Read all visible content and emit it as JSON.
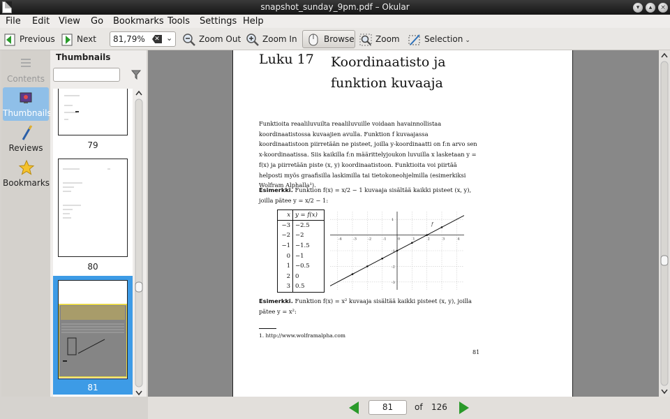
{
  "window": {
    "title": "snapshot_sunday_9pm.pdf – Okular"
  },
  "colors": {
    "accent": "#3d9be6",
    "nav_green": "#2a9a2a",
    "sidebar_active": "#8fbfe8"
  },
  "menu": [
    "File",
    "Edit",
    "View",
    "Go",
    "Bookmarks",
    "Tools",
    "Settings",
    "Help"
  ],
  "toolbar": {
    "previous": "Previous",
    "next": "Next",
    "zoom_value": "81,79%",
    "zoom_out": "Zoom Out",
    "zoom_in": "Zoom In",
    "browse": "Browse",
    "zoom": "Zoom",
    "selection": "Selection"
  },
  "sidebar": {
    "items": [
      {
        "label": "Contents",
        "icon": "contents-icon"
      },
      {
        "label": "Thumbnails",
        "icon": "thumbnails-icon"
      },
      {
        "label": "Reviews",
        "icon": "reviews-icon"
      },
      {
        "label": "Bookmarks",
        "icon": "bookmarks-star-icon"
      }
    ]
  },
  "thumbnails": {
    "title": "Thumbnails",
    "pages": [
      "79",
      "80",
      "81"
    ]
  },
  "document": {
    "chapter_number": "Luku 17",
    "chapter_title": "Koordinaatisto ja funktion kuvaaja",
    "paragraph": "Funktioita reaaliluvuilta reaaliluvuille voidaan havainnollistaa koordinaatistossa kuvaajien avulla. Funktion f kuvaajassa koordinaatistoon piirretään ne pisteet, joilla y-koordinaatti on f:n arvo sen x-koordinaatissa. Siis kaikilla f:n määrittelyjoukon luvuilla x lasketaan y = f(x) ja piirretään piste (x, y) koordinaatistoon. Funktioita voi piirtää helposti myös graafisilla laskimilla tai tietokoneohjelmilla (esimerkiksi Wolfram Alphalla¹).",
    "example1_label": "Esimerkki.",
    "example1_text": " Funktion f(x) = x/2 − 1 kuvaaja sisältää kaikki pisteet (x, y), joilla pätee y = x/2 − 1:",
    "table_headers": [
      "x",
      "y = f(x)"
    ],
    "table_rows": [
      [
        "−3",
        "−2.5"
      ],
      [
        "−2",
        "−2"
      ],
      [
        "−1",
        "−1.5"
      ],
      [
        "0",
        "−1"
      ],
      [
        "1",
        "−0.5"
      ],
      [
        "2",
        "0"
      ],
      [
        "3",
        "0.5"
      ]
    ],
    "example2_label": "Esimerkki.",
    "example2_text": " Funktion f(x) = x² kuvaaja sisältää kaikki pisteet (x, y), joilla pätee y = x²:",
    "footnote": "1.   http://www.wolframalpha.com",
    "page_number": "81"
  },
  "plot": {
    "x_ticks": [
      "-4",
      "-3",
      "-2",
      "-1",
      "0",
      "1",
      "2",
      "3",
      "4"
    ],
    "y_ticks": [
      "1",
      "-1",
      "-2",
      "-3"
    ],
    "curve_label": "f",
    "points": [
      [
        -3,
        -2.5
      ],
      [
        -2,
        -2
      ],
      [
        -1,
        -1.5
      ],
      [
        0,
        -1
      ],
      [
        1,
        -0.5
      ],
      [
        2,
        0
      ],
      [
        3,
        0.5
      ]
    ],
    "xlim": [
      -4.5,
      4.5
    ],
    "ylim": [
      -3.5,
      1.5
    ]
  },
  "navigation": {
    "current_page": "81",
    "of": "of",
    "total_pages": "126"
  }
}
